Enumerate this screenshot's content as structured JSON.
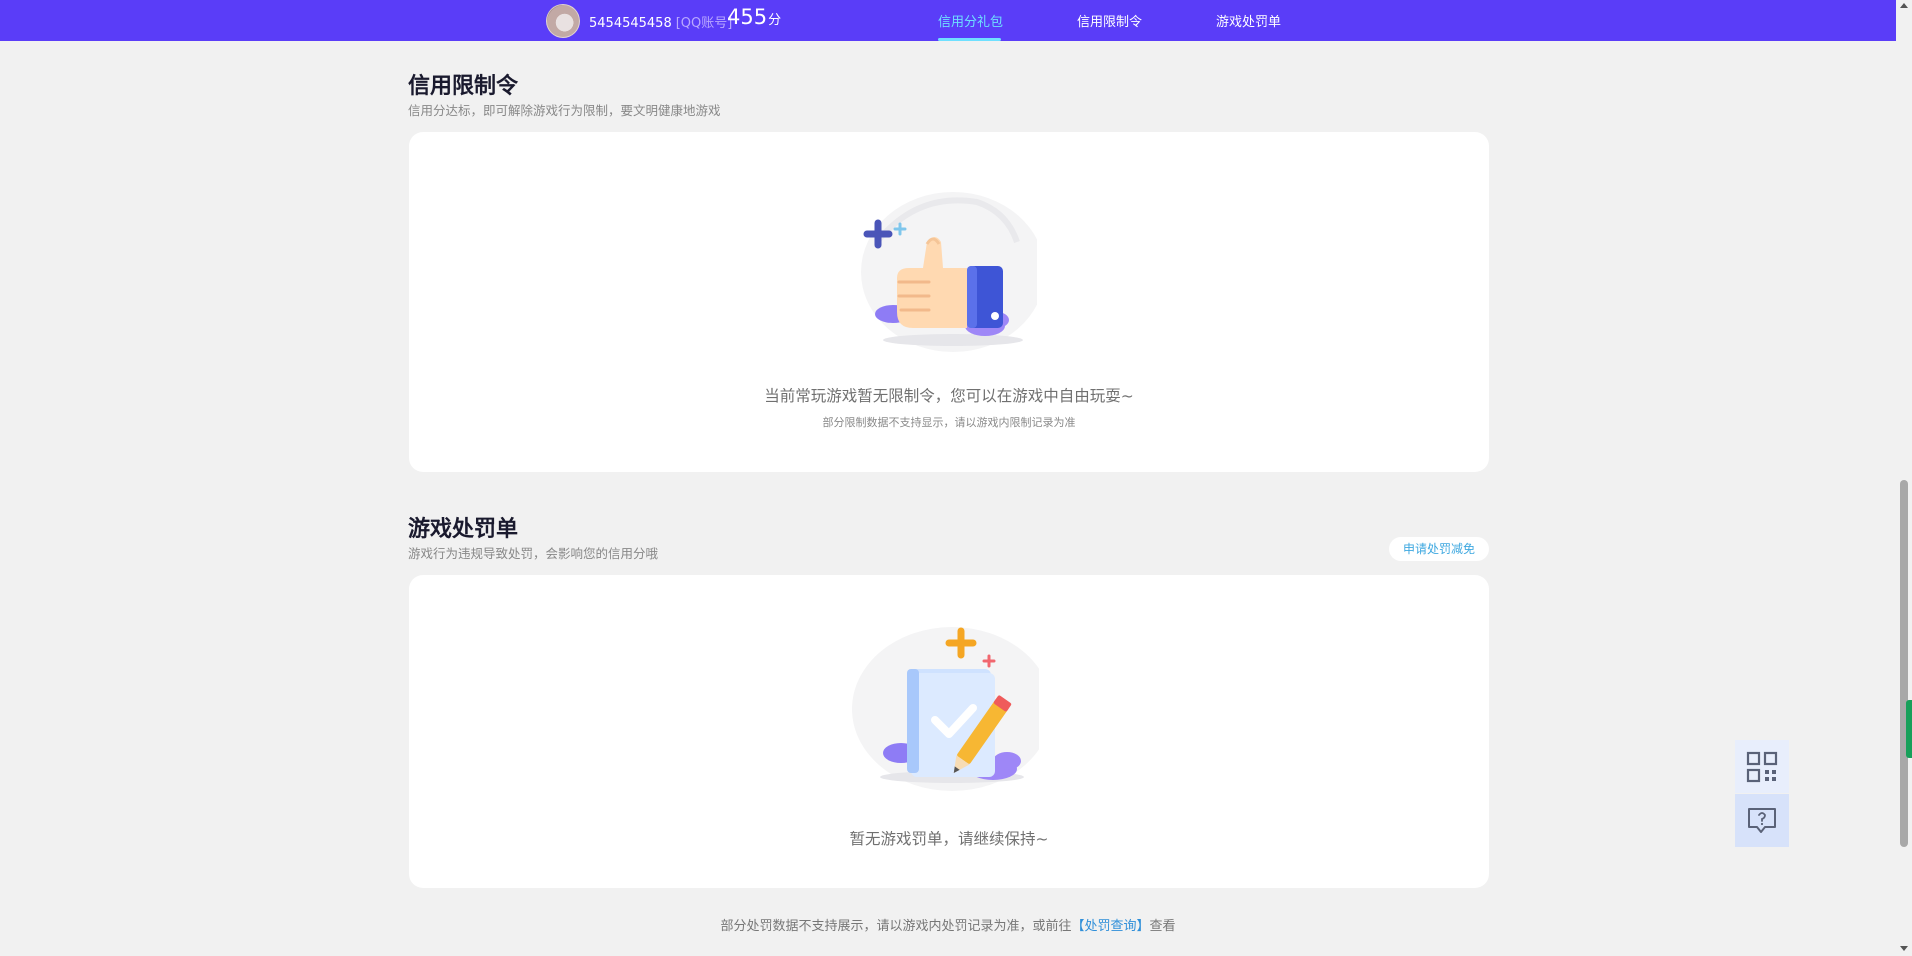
{
  "header": {
    "account_id": "5454545458",
    "account_type": "[QQ账号]",
    "score": "455",
    "score_unit": "分",
    "nav": [
      {
        "label": "信用分礼包",
        "active": true
      },
      {
        "label": "信用限制令",
        "active": false
      },
      {
        "label": "游戏处罚单",
        "active": false
      }
    ],
    "accent_color": "#5a3df8",
    "active_color": "#6fe0ff"
  },
  "restriction": {
    "title": "信用限制令",
    "subtitle": "信用分达标，即可解除游戏行为限制，要文明健康地游戏",
    "empty_message": "当前常玩游戏暂无限制令，您可以在游戏中自由玩耍~",
    "empty_note": "部分限制数据不支持显示，请以游戏内限制记录为准",
    "illustration_icon": "thumbs-up-icon"
  },
  "penalty": {
    "title": "游戏处罚单",
    "subtitle": "游戏行为违规导致处罚，会影响您的信用分哦",
    "appeal_button": "申请处罚减免",
    "empty_message": "暂无游戏罚单，请继续保持~",
    "illustration_icon": "checklist-pencil-icon"
  },
  "footer": {
    "note_prefix": "部分处罚数据不支持展示，请以游戏内处罚记录为准，或前往",
    "note_link": "【处罚查询】",
    "note_suffix": "查看"
  },
  "floating": {
    "qr_icon": "qr-code-icon",
    "help_icon": "help-chat-icon"
  }
}
